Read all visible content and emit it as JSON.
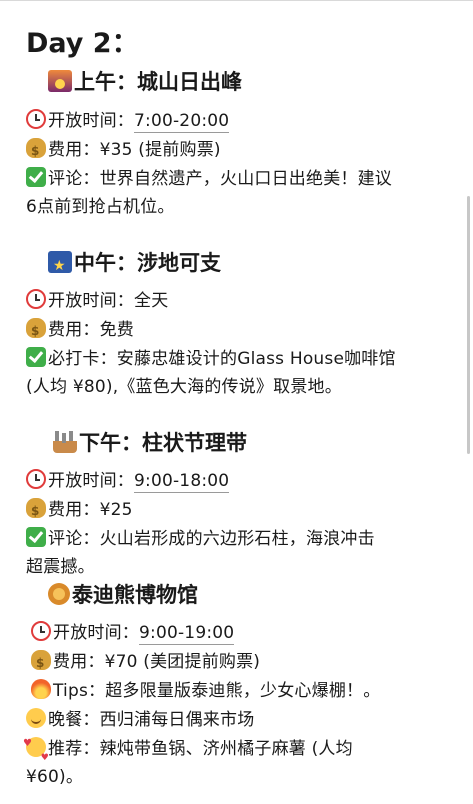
{
  "title": "Day 2：",
  "sections": [
    {
      "heading": "上午：城山日出峰",
      "icon": "sunrise-icon",
      "open_label": "开放时间：",
      "open_value": "7:00-20:00",
      "fee_label": "费用：",
      "fee_value": "¥35 (提前购票)",
      "note_line1": "评论：世界自然遗产，火山口日出绝美！建议",
      "note_line2": "6点前到抢占机位。"
    },
    {
      "heading": "中午：涉地可支",
      "icon": "shooting-star-icon",
      "open_label": "开放时间：",
      "open_value": "全天",
      "fee_label": "费用：",
      "fee_value": "免费",
      "note_line1": "必打卡：安藤忠雄设计的Glass House咖啡馆",
      "note_line2": "(人均 ¥80),《蓝色大海的传说》取景地。"
    },
    {
      "heading": "下午：柱状节理带",
      "icon": "factory-icon",
      "open_label": "开放时间：",
      "open_value": "9:00-18:00",
      "fee_label": "费用：",
      "fee_value": "¥25",
      "note_line1": "评论：火山岩形成的六边形石柱，海浪冲击",
      "note_line2": "超震撼。"
    },
    {
      "heading": "泰迪熊博物馆",
      "icon": "lion-icon",
      "open_label": "开放时间：",
      "open_value": "9:00-19:00",
      "fee_label": "费用：",
      "fee_value": "¥70 (美团提前购票)",
      "tips": "Tips：超多限量版泰迪熊，少女心爆棚！。",
      "dinner": "晚餐：西归浦每日偶来市场",
      "recommend_line1": "推荐：辣炖带鱼锅、济州橘子麻薯 (人均",
      "recommend_line2": "¥60)。"
    }
  ]
}
